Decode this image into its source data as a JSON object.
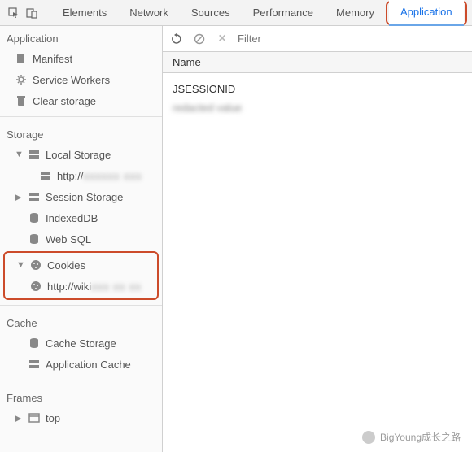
{
  "tabs": {
    "elements": "Elements",
    "network": "Network",
    "sources": "Sources",
    "performance": "Performance",
    "memory": "Memory",
    "application": "Application"
  },
  "sidebar": {
    "section_application": "Application",
    "manifest": "Manifest",
    "service_workers": "Service Workers",
    "clear_storage": "Clear storage",
    "section_storage": "Storage",
    "local_storage": "Local Storage",
    "local_storage_item": "http://",
    "session_storage": "Session Storage",
    "indexeddb": "IndexedDB",
    "websql": "Web SQL",
    "cookies": "Cookies",
    "cookies_item": "http://wiki",
    "section_cache": "Cache",
    "cache_storage": "Cache Storage",
    "app_cache": "Application Cache",
    "section_frames": "Frames",
    "top": "top"
  },
  "toolbar": {
    "filter_placeholder": "Filter"
  },
  "name_panel": {
    "header": "Name",
    "items": [
      "JSESSIONID",
      "redacted value"
    ]
  },
  "watermark": "BigYoung成长之路"
}
